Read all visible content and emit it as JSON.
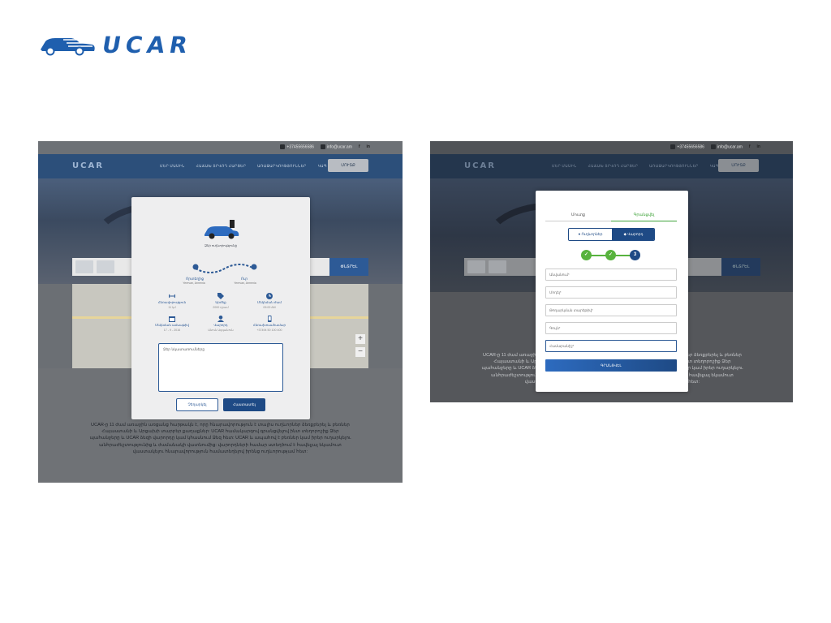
{
  "brand": {
    "name": "UCAR",
    "color": "#1f5fae"
  },
  "site": {
    "phone": "+37455656586",
    "email": "info@ucar.am",
    "social": [
      "f",
      "in"
    ],
    "logo_text": "UCAR",
    "nav": [
      "ՄԵՐ ՄԱՍԻՆ",
      "ՀԱՃԱԽ ՏՐՎՈՂ ՀԱՐՑԵՐ",
      "ԱՌԱՋԱՐԿՈՒԹՅՈՒՆՆԵՐ",
      "ԿԱՊ ՄԵԶ ՀԵՏ"
    ],
    "login_label": "ՄՈՒՏՔ",
    "search_button": "ՓՆՏՐԵԼ"
  },
  "order_modal": {
    "caption": "Ձեր ուղևորությունը",
    "from_label": "Որտեղից",
    "from_place": "Yerevan, Armenia",
    "to_label": "Ուր",
    "to_place": "Yerevan, Armenia",
    "info": [
      {
        "icon": "distance-icon",
        "label": "Հեռավորություն",
        "value": "11 կմ"
      },
      {
        "icon": "price-tag-icon",
        "label": "Արժեք",
        "value": "2000 դրամ"
      },
      {
        "icon": "clock-icon",
        "label": "Մեկնման ժամ",
        "value": "09:00 AM"
      },
      {
        "icon": "calendar-icon",
        "label": "Մեկնման ամսաթիվ",
        "value": "17 - 9 - 2016"
      },
      {
        "icon": "driver-icon",
        "label": "Վարորդ",
        "value": "Անուն Ազգանուն"
      },
      {
        "icon": "phone-icon",
        "label": "Հեռախոսահամար",
        "value": "+37494 50 100 400"
      }
    ],
    "comment_placeholder": "Ձեր նկատառումները",
    "cancel_label": "Չեղարկել",
    "confirm_label": "Հաստատել"
  },
  "register_modal": {
    "tabs": {
      "login": "Մուտք",
      "register": "Գրանցվել"
    },
    "roles": {
      "passenger": "Ուղևորներ",
      "driver": "Վարորդ"
    },
    "steps": [
      "✓",
      "✓",
      "3"
    ],
    "fields": [
      {
        "placeholder": "Անվանում*"
      },
      {
        "placeholder": "Մոդել*"
      },
      {
        "placeholder": "Թողարկման տարեթիվ*"
      },
      {
        "placeholder": "Գույն*"
      },
      {
        "placeholder": "Համարանիշ*"
      }
    ],
    "submit_label": "ԳՐԱՆՑՎԵԼ"
  },
  "about": {
    "title": "ՄԵՐ ՄԱՍԻՆ",
    "text": "UCAR-ը 11 ժամ առաջին առցանց հարթակն է, որը հնարավորություն է տալիս ուղևորներ ձեռքբերել և բեռներ Հայաստանի և Արցախի տարբեր քաղաքներ: UCAR համակարգով գրանցվելով ինտ տեղորոշիք Ձեր պահանջերը և UCAR ձեզի վարորդը կամ կհասնում Ձեզ հետ: UCAR և ապահով է բեռներ կամ իրեր ուղարկելու անհրաժեշտությունից և ժամանակի վատնումից: վարորդների համար ստեղծում է հավելյալ եկամուտ վաստակելու հնարավորություն համատեղելով իրենց ուղևորությամ հետ:"
  }
}
